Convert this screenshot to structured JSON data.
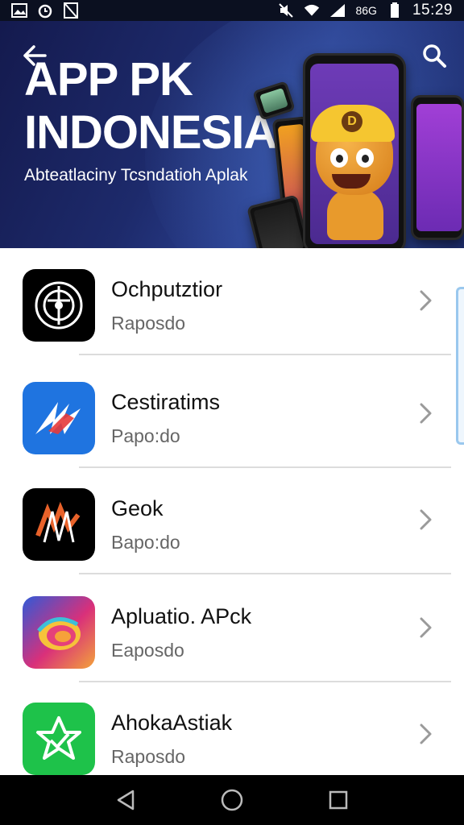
{
  "status_bar": {
    "time": "15:29",
    "network_label": "86G",
    "icons": [
      "image-icon",
      "alarm-icon",
      "sim-blocked-icon",
      "mute-icon",
      "wifi-icon",
      "signal-icon",
      "battery-icon"
    ]
  },
  "header": {
    "title_line1": "APP PK",
    "title_line2": "INDONESIA",
    "subtitle": "Abteatlaciny Tcsndatioh Aplak",
    "back_icon": "back-arrow-icon",
    "search_icon": "search-icon"
  },
  "apps": [
    {
      "name": "Ochputztior",
      "subtitle": "Raposdo",
      "icon": "vinyl-record-icon",
      "icon_bg": "#000000"
    },
    {
      "name": "Cestiratims",
      "subtitle": "Papo:do",
      "icon": "ak-logo-icon",
      "icon_bg": "#1f74e0"
    },
    {
      "name": "Geok",
      "subtitle": "Bapo:do",
      "icon": "zigzag-logo-icon",
      "icon_bg": "#000000"
    },
    {
      "name": "Apluatio. APck",
      "subtitle": "Eaposdo",
      "icon": "colorful-swirl-icon",
      "icon_bg": "#d9307a"
    },
    {
      "name": "AhokaAstiak",
      "subtitle": "Raposdo",
      "icon": "star-arrow-icon",
      "icon_bg": "#1ec24a"
    }
  ],
  "nav_bar": {
    "back": "triangle-back-icon",
    "home": "circle-home-icon",
    "recents": "square-recents-icon"
  },
  "colors": {
    "banner_start": "#141a4e",
    "banner_end": "#2a3f8e",
    "divider": "#dcdcdc",
    "subtitle_text": "#666666"
  }
}
